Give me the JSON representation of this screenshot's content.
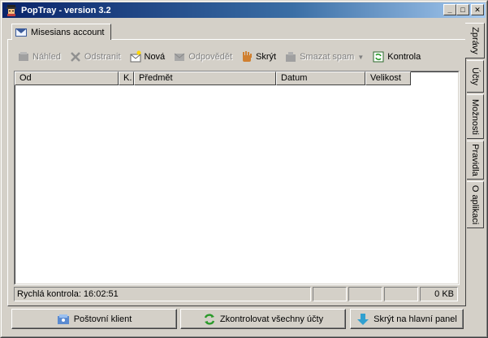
{
  "window": {
    "title": "PopTray - version 3.2",
    "minimize": "_",
    "maximize": "□",
    "close": "✕"
  },
  "account_tab": {
    "label": "Misesians account"
  },
  "toolbar": {
    "preview": "Náhled",
    "delete": "Odstranit",
    "new": "Nová",
    "reply": "Odpovědět",
    "hide": "Skrýt",
    "delete_spam": "Smazat spam",
    "check": "Kontrola"
  },
  "columns": [
    "Od",
    "K.",
    "Předmět",
    "Datum",
    "Velikost"
  ],
  "status": {
    "quick_check": "Rychlá kontrola: 16:02:51",
    "size": "0 KB"
  },
  "buttons": {
    "mail_client": "Poštovní klient",
    "check_all": "Zkontrolovat všechny účty",
    "hide_to_tray": "Skrýt na hlavní panel"
  },
  "side_tabs": [
    "Zprávy",
    "Účty",
    "Možnosti",
    "Pravidla",
    "O aplikaci"
  ],
  "colors": {
    "titlebar_start": "#0a246a",
    "titlebar_end": "#a6caf0",
    "face": "#d4d0c8"
  }
}
